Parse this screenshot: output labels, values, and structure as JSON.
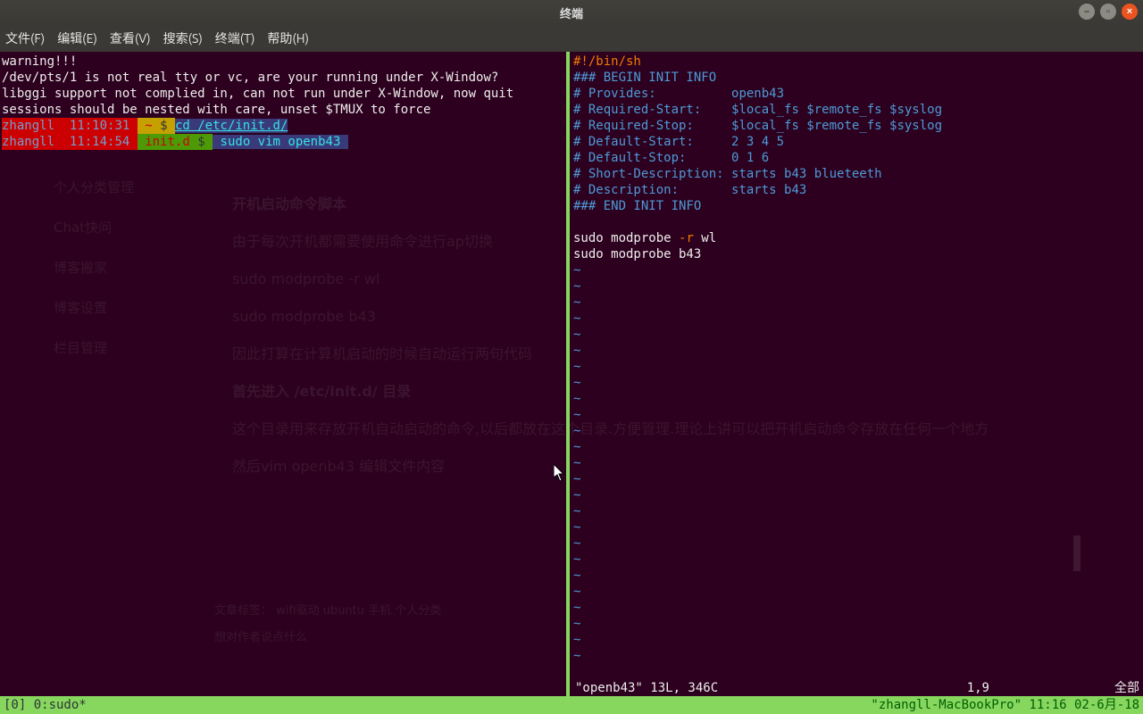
{
  "window": {
    "title": "终端",
    "controls": {
      "min": "–",
      "max": "▫",
      "close": "×"
    }
  },
  "menubar": {
    "file": "文件(F)",
    "edit": "编辑(E)",
    "view": "查看(V)",
    "search": "搜索(S)",
    "terminal": "终端(T)",
    "help": "帮助(H)"
  },
  "left_pane": {
    "warn1": "warning!!!",
    "warn2": "/dev/pts/1 is not real tty or vc, are your running under X-Window?",
    "warn3": "libggi support not complied in, can not run under X-Window, now quit",
    "warn4": "sessions should be nested with care, unset $TMUX to force",
    "prompt1": {
      "user": "zhangll",
      "time": "11:10:31",
      "dir": "~",
      "sym": "$",
      "cmd": "cd /etc/init.d/"
    },
    "prompt2": {
      "user": "zhangll",
      "time": "11:14:54",
      "dir": "init.d",
      "sym": "$",
      "cmd": "sudo vim openb43"
    }
  },
  "right_pane": {
    "l1": "#!/bin/sh",
    "l2": "### BEGIN INIT INFO",
    "l3a": "# Provides:          ",
    "l3b": "openb43",
    "l4a": "# Required-Start:    ",
    "l4b": "$local_fs $remote_fs $syslog",
    "l5a": "# Required-Stop:     ",
    "l5b": "$local_fs $remote_fs $syslog",
    "l6a": "# Default-Start:     ",
    "l6b": "2 3 4 5",
    "l7a": "# Default-Stop:      ",
    "l7b": "0 1 6",
    "l8a": "# Short-Description: ",
    "l8b": "starts b43 blueteeth",
    "l9a": "# Description:       ",
    "l9b": "starts b43",
    "l10": "### END INIT INFO",
    "blank": " ",
    "cmd1a": "sudo modprobe ",
    "cmd1b": "-r",
    "cmd1c": " wl",
    "cmd2": "sudo modprobe b43",
    "tilde": "~",
    "status_file": "\"openb43\" 13L, 346C",
    "status_pos": "1,9",
    "status_pct": "全部"
  },
  "tmux": {
    "left": "[0] 0:sudo*",
    "right": "\"zhangll-MacBookPro\" 11:16 02-6月-18"
  },
  "ghost": {
    "s1": "个人分类管理",
    "s2": "Chat快问",
    "s3": "博客搬家",
    "s4": "博客设置",
    "s5": "栏目管理",
    "m1": "开机启动命令脚本",
    "m2": "由于每次开机都需要使用命令进行ap切换",
    "m3": "sudo modprobe -r wl",
    "m4": "sudo modprobe b43",
    "m5": "因此打算在计算机启动的时候自动运行两句代码",
    "m6": "首先进入 /etc/init.d/ 目录",
    "m7": "这个目录用来存放开机自动启动的命令,以后都放在这个目录.方便管理.理论上讲可以把开机启动命令存放在任何一个地方",
    "m8": "然后vim openb43 编辑文件内容",
    "f1": "文章标签：   wifi驱动        ubuntu        手机        个人分类",
    "f2": "想对作者说点什么"
  }
}
